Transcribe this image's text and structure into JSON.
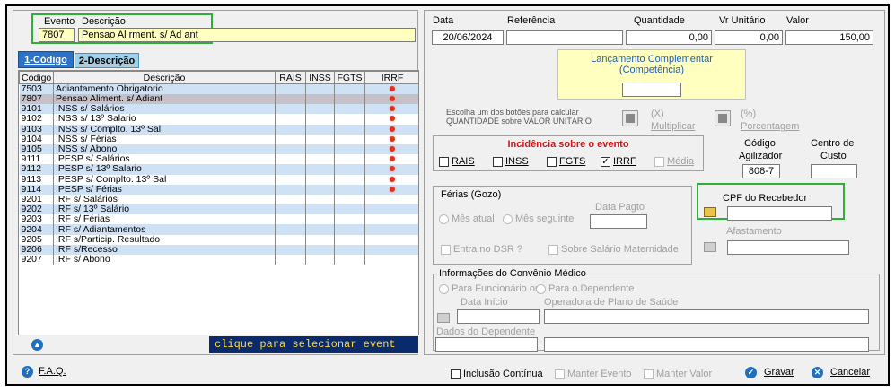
{
  "header": {
    "evento_label": "Evento",
    "descricao_label": "Descrição",
    "evento_value": "7807",
    "descricao_value": "Pensao Al rment. s/ Ad ant"
  },
  "tabs": [
    {
      "label": "1-Código"
    },
    {
      "label": "2-Descrição"
    }
  ],
  "grid": {
    "columns": [
      "Código",
      "Descrição",
      "RAIS",
      "INSS",
      "FGTS",
      "IRRF"
    ],
    "rows": [
      {
        "code": "7503",
        "desc": "Adiantamento Obrigatorio",
        "irrf": true
      },
      {
        "code": "7807",
        "desc": "Pensao Aliment. s/ Adiant",
        "irrf": true
      },
      {
        "code": "9101",
        "desc": "INSS s/ Salários",
        "irrf": true
      },
      {
        "code": "9102",
        "desc": "INSS s/ 13º Salario",
        "irrf": true
      },
      {
        "code": "9103",
        "desc": "INSS s/ Complto. 13º Sal.",
        "irrf": true
      },
      {
        "code": "9104",
        "desc": "INSS s/ Férias",
        "irrf": true
      },
      {
        "code": "9105",
        "desc": "INSS s/ Abono",
        "irrf": true
      },
      {
        "code": "9111",
        "desc": "IPESP s/ Salários",
        "irrf": true
      },
      {
        "code": "9112",
        "desc": "IPESP s/ 13º Salario",
        "irrf": true
      },
      {
        "code": "9113",
        "desc": "IPESP s/ Complto. 13º Sal",
        "irrf": true
      },
      {
        "code": "9114",
        "desc": "IPESP s/ Férias",
        "irrf": true
      },
      {
        "code": "9201",
        "desc": "IRF s/ Salários",
        "irrf": false
      },
      {
        "code": "9202",
        "desc": "IRF s/ 13º Salário",
        "irrf": false
      },
      {
        "code": "9203",
        "desc": "IRF s/ Férias",
        "irrf": false
      },
      {
        "code": "9204",
        "desc": "IRF s/ Adiantamentos",
        "irrf": false
      },
      {
        "code": "9205",
        "desc": "IRF s/Particip. Resultado",
        "irrf": false
      },
      {
        "code": "9206",
        "desc": "IRF s/Recesso",
        "irrf": false
      },
      {
        "code": "9207",
        "desc": "IRF s/ Abono",
        "irrf": false
      }
    ],
    "selected_index": 1,
    "hint": "clique para selecionar event"
  },
  "right": {
    "data_label": "Data",
    "referencia_label": "Referência",
    "quantidade_label": "Quantidade",
    "vr_unitario_label": "Vr Unitário",
    "valor_label": "Valor",
    "data_value": "20/06/2024",
    "referencia_value": "",
    "quantidade_value": "0,00",
    "vr_unitario_value": "0,00",
    "valor_value": "150,00",
    "lanc_line1": "Lançamento Complementar",
    "lanc_line2": "(Competência)",
    "calc_hint_line1": "Escolha um dos botões para calcular",
    "calc_hint_line2": "QUANTIDADE sobre VALOR UNITÁRIO",
    "mult_symbol": "(X)",
    "mult_label": "Multiplicar",
    "pct_symbol": "(%)",
    "pct_label": "Porcentagem",
    "codigo_agilizador_line1": "Código",
    "codigo_agilizador_line2": "Agilizador",
    "codigo_agilizador_value": "808-7",
    "centro_custo_line1": "Centro de",
    "centro_custo_line2": "Custo",
    "incidencia_title": "Incidência sobre o evento",
    "incidencia": [
      {
        "label": "RAIS",
        "checked": false
      },
      {
        "label": "INSS",
        "checked": false
      },
      {
        "label": "FGTS",
        "checked": false
      },
      {
        "label": "IRRF",
        "checked": true
      },
      {
        "label": "Média",
        "checked": false
      }
    ],
    "ferias_title": "Férias (Gozo)",
    "data_pagto_label": "Data Pagto",
    "mes_atual_label": "Mês atual",
    "mes_seguinte_label": "Mês seguinte",
    "entra_dsr_label": "Entra no DSR ?",
    "sobre_maternidade_label": "Sobre Salário Maternidade",
    "cpf_label": "CPF do Recebedor",
    "afastamento_label": "Afastamento",
    "convenio_title": "Informações do Convênio Médico",
    "para_funcionario_label": "Para Funcionário ou",
    "para_dependente_label": "Para o Dependente",
    "data_inicio_label": "Data Início",
    "operadora_label": "Operadora de Plano de Saúde",
    "dados_dependente_label": "Dados do Dependente"
  },
  "footer": {
    "faq_label": "F.A.Q.",
    "inclusao_label": "Inclusão Contínua",
    "manter_evento_label": "Manter Evento",
    "manter_valor_label": "Manter Valor",
    "gravar_label": "Gravar",
    "cancelar_label": "Cancelar"
  },
  "colors": {
    "accent": "#1f6fc0",
    "highlight_green": "#2fae3c",
    "incidencia_red": "#d4141a",
    "row_blue": "#cfe1f5",
    "row_selected": "#c8c0c8",
    "hint_bg": "#0a2a6e",
    "hint_fg": "#ffd83a",
    "input_yellow": "#ffffc0"
  }
}
